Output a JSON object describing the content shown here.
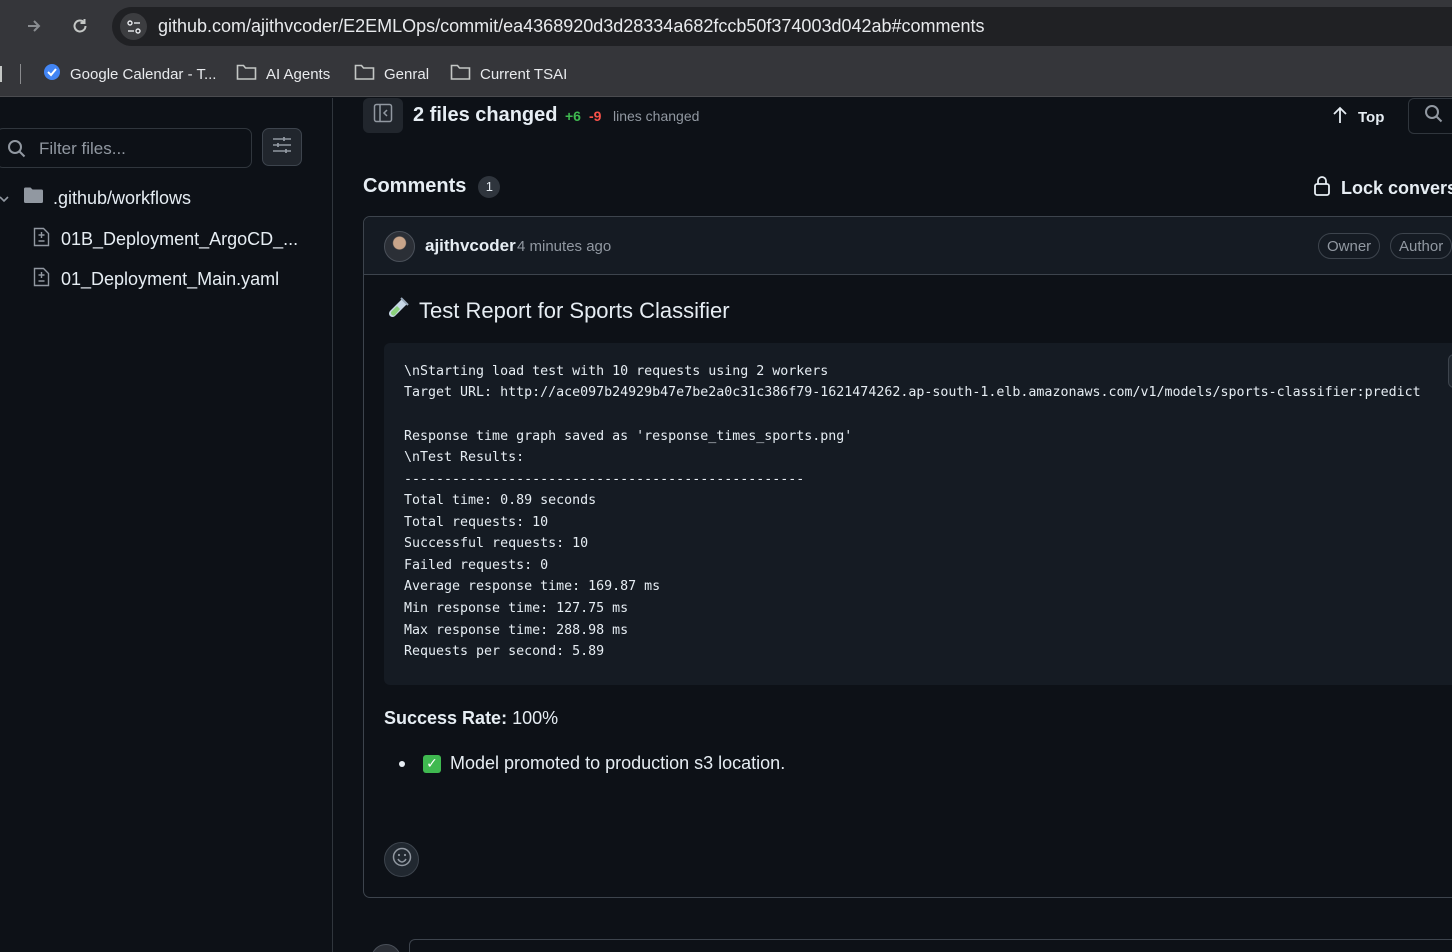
{
  "browser": {
    "url": "github.com/ajithvcoder/E2EMLOps/commit/ea4368920d3d28334a682fccb50f374003d042ab#comments",
    "bookmarks": [
      "Google Calendar - T...",
      "AI Agents",
      "Genral",
      "Current TSAI"
    ]
  },
  "sidebar": {
    "filter_placeholder": "Filter files...",
    "folder": ".github/workflows",
    "files": [
      "01B_Deployment_ArgoCD_...",
      "01_Deployment_Main.yaml"
    ]
  },
  "toolbar": {
    "files_changed": "2 files changed",
    "additions": "+6",
    "deletions": "-9",
    "lines_changed": "lines changed",
    "top_label": "Top"
  },
  "comments": {
    "heading": "Comments",
    "count": "1",
    "lock_label": "Lock conversa"
  },
  "comment": {
    "author": "ajithvcoder",
    "time_ago": "4 minutes ago",
    "badges": [
      "Owner",
      "Author"
    ],
    "title": "Test Report for Sports Classifier",
    "code_lines": [
      "\\nStarting load test with 10 requests using 2 workers",
      "Target URL: http://ace097b24929b47e7be2a0c31c386f79-1621474262.ap-south-1.elb.amazonaws.com/v1/models/sports-classifier:predict",
      "",
      "Response time graph saved as 'response_times_sports.png'",
      "\\nTest Results:",
      "--------------------------------------------------",
      "Total time: 0.89 seconds",
      "Total requests: 10",
      "Successful requests: 10",
      "Failed requests: 0",
      "Average response time: 169.87 ms",
      "Min response time: 127.75 ms",
      "Max response time: 288.98 ms",
      "Requests per second: 5.89"
    ],
    "success_label": "Success Rate:",
    "success_value": "100%",
    "bullet": "Model promoted to production s3 location."
  }
}
